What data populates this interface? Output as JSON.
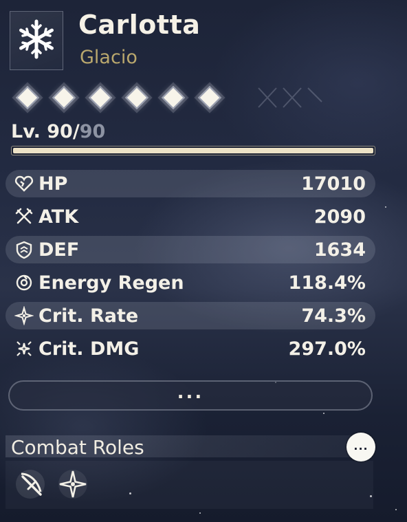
{
  "character": {
    "name": "Carlotta",
    "element": "Glacio",
    "element_icon": "snowflake-icon",
    "resonance_nodes": 6
  },
  "level": {
    "current": "Lv. 90/",
    "max": "90",
    "progress": 1.0
  },
  "stats": [
    {
      "icon": "hp-heart-icon",
      "label": "HP",
      "value": "17010"
    },
    {
      "icon": "atk-crossed-swords-icon",
      "label": "ATK",
      "value": "2090"
    },
    {
      "icon": "def-shield-icon",
      "label": "DEF",
      "value": "1634"
    },
    {
      "icon": "energy-regen-icon",
      "label": "Energy Regen",
      "value": "118.4%"
    },
    {
      "icon": "crit-rate-icon",
      "label": "Crit. Rate",
      "value": "74.3%"
    },
    {
      "icon": "crit-dmg-icon",
      "label": "Crit. DMG",
      "value": "297.0%"
    }
  ],
  "more_button": {
    "label": "..."
  },
  "combat_roles": {
    "title": "Combat Roles",
    "info_label": "...",
    "roles": [
      {
        "icon": "sword-role-icon"
      },
      {
        "icon": "sparkle-role-icon"
      }
    ]
  },
  "colors": {
    "accent_gold": "#b9a76d",
    "text_primary": "#f3f0e7",
    "text_muted": "#8d93a3"
  }
}
